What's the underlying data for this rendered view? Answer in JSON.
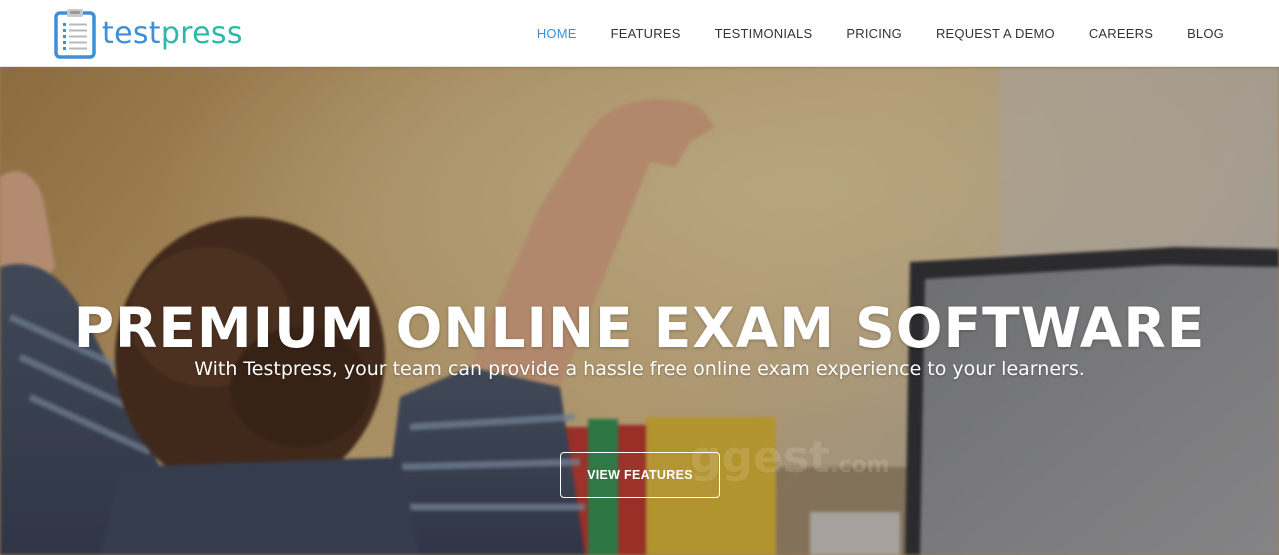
{
  "brand": {
    "name_part_a": "test",
    "name_part_b": "press",
    "logo_icon": "clipboard-checklist-icon",
    "colors": {
      "primary": "#3d8fd6",
      "secondary": "#2fb8a9"
    }
  },
  "nav": {
    "items": [
      {
        "label": "HOME",
        "active": true
      },
      {
        "label": "FEATURES",
        "active": false
      },
      {
        "label": "TESTIMONIALS",
        "active": false
      },
      {
        "label": "PRICING",
        "active": false
      },
      {
        "label": "REQUEST A DEMO",
        "active": false
      },
      {
        "label": "CAREERS",
        "active": false
      },
      {
        "label": "BLOG",
        "active": false
      }
    ],
    "active_color": "#3d8fd6",
    "text_color": "#333333"
  },
  "hero": {
    "title": "PREMIUM ONLINE EXAM SOFTWARE",
    "subtitle": "With Testpress, your team can provide a hassle free online exam experience to your learners.",
    "cta_label": "VIEW FEATURES",
    "watermark": "ggest",
    "watermark_tld": ".com"
  }
}
